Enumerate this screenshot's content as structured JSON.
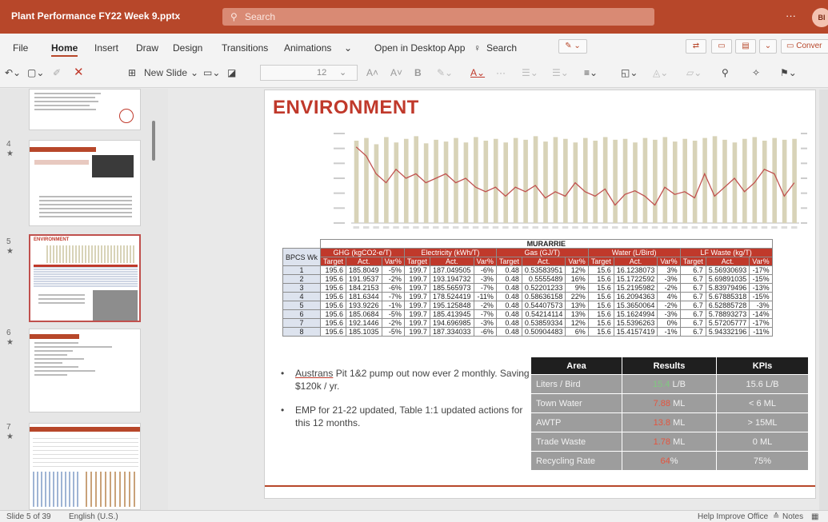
{
  "titlebar": {
    "app_title": "Plant Performance FY22 Week 9.pptx",
    "search_placeholder": "Search",
    "more": "···",
    "avatar_initials": "BI"
  },
  "ribbon": {
    "tabs": [
      "File",
      "Home",
      "Insert",
      "Draw",
      "Design",
      "Transitions",
      "Animations",
      "Open in Desktop App",
      "Search"
    ],
    "active_tab": "Home",
    "convert_label": "Conver"
  },
  "toolbar": {
    "new_slide_label": "New Slide",
    "font_size": "12",
    "bold": "B"
  },
  "thumbnails": [
    {
      "number": "4",
      "star": "★"
    },
    {
      "number": "5",
      "star": "★",
      "title": "ENVIRONMENT"
    },
    {
      "number": "6",
      "star": "★"
    },
    {
      "number": "7",
      "star": "★"
    }
  ],
  "slide": {
    "title": "ENVIRONMENT",
    "site_name": "MURARRIE",
    "week_header": "BPCS Wk",
    "groups": [
      "GHG (kgCO2-e/T)",
      "Electricity (kWh/T)",
      "Gas (GJ/T)",
      "Water (L/Bird)",
      "LF Waste (kg/T)"
    ],
    "sub_headers": [
      "Target",
      "Act.",
      "Var%"
    ],
    "rows": [
      {
        "wk": "1",
        "vals": [
          "195.6",
          "185.8049",
          "-5%",
          "199.7",
          "187.049505",
          "-6%",
          "0.48",
          "0.53583951",
          "12%",
          "15.6",
          "16.1238073",
          "3%",
          "6.7",
          "5.56930693",
          "-17%"
        ]
      },
      {
        "wk": "2",
        "vals": [
          "195.6",
          "191.9537",
          "-2%",
          "199.7",
          "193.194732",
          "-3%",
          "0.48",
          "0.5555489",
          "16%",
          "15.6",
          "15.1722592",
          "-3%",
          "6.7",
          "5.69891035",
          "-15%"
        ]
      },
      {
        "wk": "3",
        "vals": [
          "195.6",
          "184.2153",
          "-6%",
          "199.7",
          "185.565973",
          "-7%",
          "0.48",
          "0.52201233",
          "9%",
          "15.6",
          "15.2195982",
          "-2%",
          "6.7",
          "5.83979496",
          "-13%"
        ]
      },
      {
        "wk": "4",
        "vals": [
          "195.6",
          "181.6344",
          "-7%",
          "199.7",
          "178.524419",
          "-11%",
          "0.48",
          "0.58636158",
          "22%",
          "15.6",
          "16.2094363",
          "4%",
          "6.7",
          "5.67885318",
          "-15%"
        ]
      },
      {
        "wk": "5",
        "vals": [
          "195.6",
          "193.9226",
          "-1%",
          "199.7",
          "195.125848",
          "-2%",
          "0.48",
          "0.54407573",
          "13%",
          "15.6",
          "15.3650064",
          "-2%",
          "6.7",
          "6.52885728",
          "-3%"
        ]
      },
      {
        "wk": "6",
        "vals": [
          "195.6",
          "185.0684",
          "-5%",
          "199.7",
          "185.413945",
          "-7%",
          "0.48",
          "0.54214114",
          "13%",
          "15.6",
          "15.1624994",
          "-3%",
          "6.7",
          "5.78893273",
          "-14%"
        ]
      },
      {
        "wk": "7",
        "vals": [
          "195.6",
          "192.1446",
          "-2%",
          "199.7",
          "194.696985",
          "-3%",
          "0.48",
          "0.53859334",
          "12%",
          "15.6",
          "15.5396263",
          "0%",
          "6.7",
          "5.57205777",
          "-17%"
        ]
      },
      {
        "wk": "8",
        "vals": [
          "195.6",
          "185.1035",
          "-5%",
          "199.7",
          "187.334033",
          "-6%",
          "0.48",
          "0.50904483",
          "6%",
          "15.6",
          "15.4157419",
          "-1%",
          "6.7",
          "5.94332196",
          "-11%"
        ]
      }
    ],
    "bullets": [
      {
        "underlined": "Austrans",
        "text": " Pit 1&2 pump out now ever 2 monthly. Saving $120k / yr."
      },
      {
        "underlined": "",
        "text": "EMP for 21-22 updated, Table 1:1 updated actions for this 12 months."
      }
    ],
    "kpi": {
      "headers": [
        "Area",
        "Results",
        "KPIs"
      ],
      "rows": [
        {
          "area": "Liters / Bird",
          "result_value": "15.4",
          "result_unit": " L/B",
          "result_color": "green",
          "kpi": "15.6 L/B"
        },
        {
          "area": "Town Water",
          "result_value": "7.88",
          "result_unit": " ML",
          "result_color": "red",
          "kpi": "< 6 ML"
        },
        {
          "area": "AWTP",
          "result_value": "13.8",
          "result_unit": " ML",
          "result_color": "red",
          "kpi": "> 15ML"
        },
        {
          "area": "Trade Waste",
          "result_value": "1.78",
          "result_unit": " ML",
          "result_color": "red",
          "kpi": "0 ML"
        },
        {
          "area": "Recycling Rate",
          "result_value": "64",
          "result_unit": "%",
          "result_color": "red",
          "kpi": "75%"
        }
      ]
    }
  },
  "chart_data": {
    "type": "bar",
    "title": "",
    "bars_count": 45,
    "bar_color": "#d8d3b8",
    "line_color": "#c0504d",
    "values_relative": [
      0.92,
      0.95,
      0.88,
      0.96,
      0.9,
      0.94,
      0.97,
      0.89,
      0.93,
      0.91,
      0.95,
      0.9,
      0.96,
      0.92,
      0.94,
      0.9,
      0.95,
      0.93,
      0.97,
      0.91,
      0.96,
      0.94,
      0.9,
      0.95,
      0.92,
      0.96,
      0.93,
      0.94,
      0.9,
      0.95,
      0.93,
      0.96,
      0.91,
      0.94,
      0.92,
      0.95,
      0.97,
      0.93,
      0.9,
      0.94,
      0.96,
      0.92,
      0.95,
      0.93,
      0.94
    ],
    "line_relative": [
      0.85,
      0.75,
      0.55,
      0.45,
      0.6,
      0.5,
      0.55,
      0.45,
      0.5,
      0.55,
      0.45,
      0.5,
      0.4,
      0.35,
      0.4,
      0.3,
      0.4,
      0.35,
      0.42,
      0.28,
      0.35,
      0.3,
      0.45,
      0.35,
      0.3,
      0.38,
      0.2,
      0.32,
      0.36,
      0.3,
      0.2,
      0.4,
      0.32,
      0.35,
      0.28,
      0.55,
      0.3,
      0.4,
      0.5,
      0.35,
      0.45,
      0.6,
      0.55,
      0.3,
      0.45
    ]
  },
  "statusbar": {
    "slide_info": "Slide 5 of 39",
    "language": "English (U.S.)",
    "help": "Help Improve Office",
    "notes": "Notes"
  }
}
